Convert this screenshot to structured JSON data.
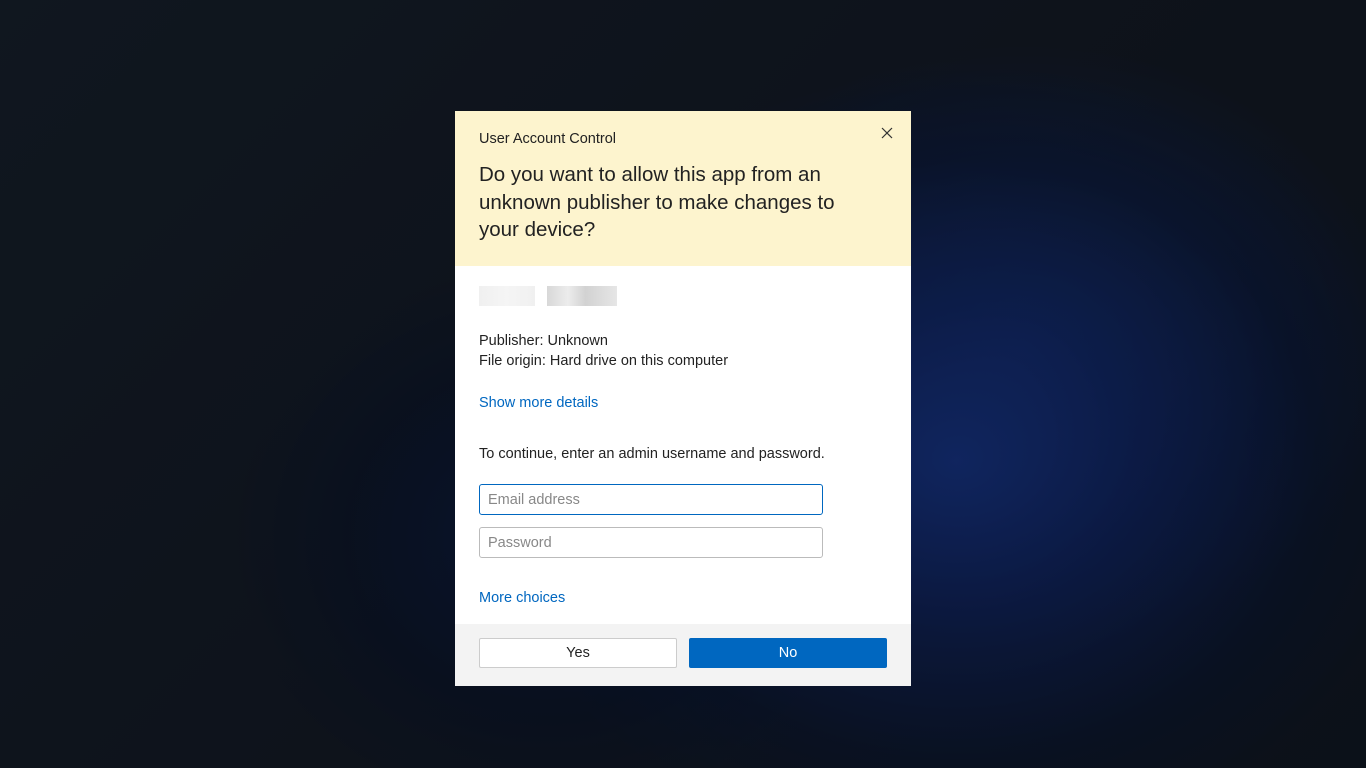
{
  "dialog": {
    "title": "User Account Control",
    "prompt": "Do you want to allow this app from an unknown publisher to make changes to your device?",
    "publisher": "Publisher: Unknown",
    "file_origin": "File origin: Hard drive on this computer",
    "details_link": "Show more details",
    "continue_text": "To continue, enter an admin username and password.",
    "email_placeholder": "Email address",
    "password_placeholder": "Password",
    "more_choices": "More choices",
    "yes_label": "Yes",
    "no_label": "No"
  }
}
